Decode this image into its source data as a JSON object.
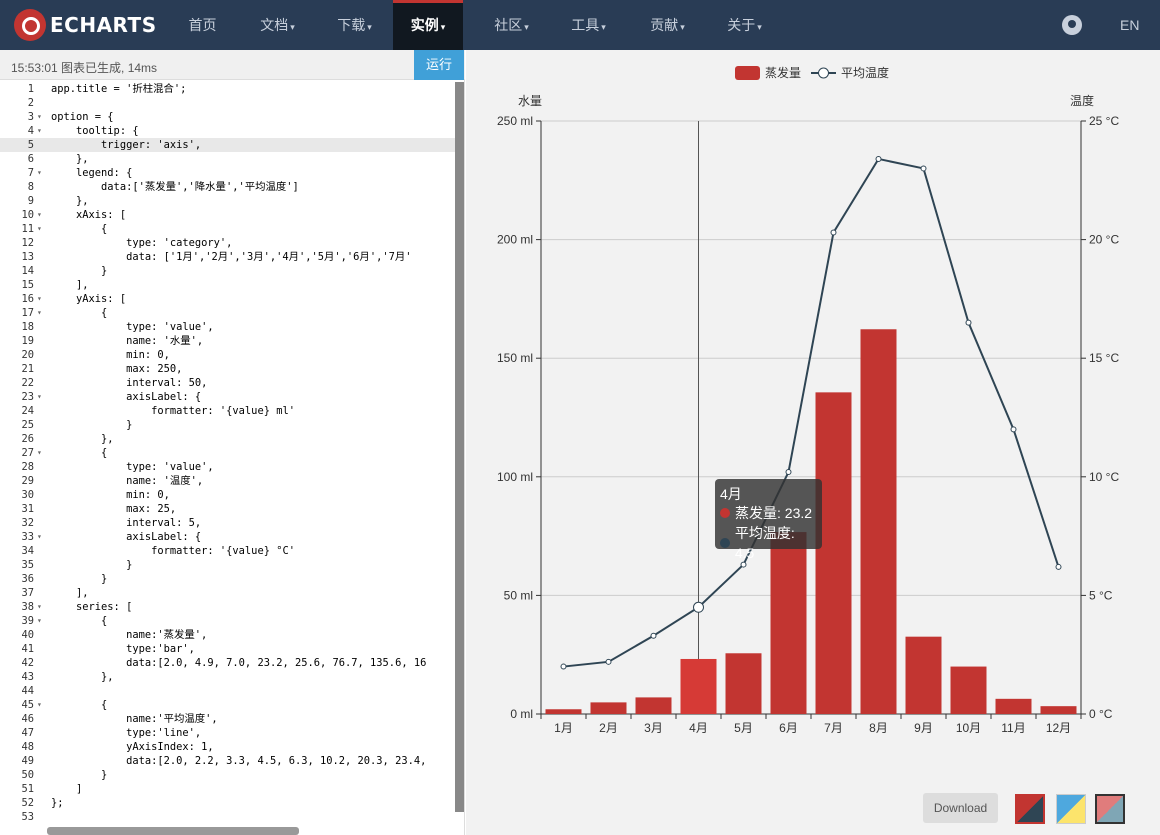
{
  "nav": {
    "logo": "ECHARTS",
    "items": [
      {
        "label": "首页",
        "caret": ""
      },
      {
        "label": "文档",
        "caret": "▾"
      },
      {
        "label": "下载",
        "caret": "▾"
      },
      {
        "label": "实例",
        "caret": "▾"
      },
      {
        "label": "社区",
        "caret": "▾"
      },
      {
        "label": "工具",
        "caret": "▾"
      },
      {
        "label": "贡献",
        "caret": "▾"
      },
      {
        "label": "关于",
        "caret": "▾"
      }
    ],
    "active_index": 3,
    "lang": "EN"
  },
  "editor": {
    "status": "15:53:01   图表已生成, 14ms",
    "run_label": "运行",
    "active_line": 5,
    "lines": [
      {
        "n": "1",
        "fold": "",
        "text": "app.title = '折柱混合';"
      },
      {
        "n": "2",
        "fold": "",
        "text": ""
      },
      {
        "n": "3",
        "fold": "▾",
        "text": "option = {"
      },
      {
        "n": "4",
        "fold": "▾",
        "text": "    tooltip: {"
      },
      {
        "n": "5",
        "fold": "",
        "text": "        trigger: 'axis',"
      },
      {
        "n": "6",
        "fold": "",
        "text": "    },"
      },
      {
        "n": "7",
        "fold": "▾",
        "text": "    legend: {"
      },
      {
        "n": "8",
        "fold": "",
        "text": "        data:['蒸发量','降水量','平均温度']"
      },
      {
        "n": "9",
        "fold": "",
        "text": "    },"
      },
      {
        "n": "10",
        "fold": "▾",
        "text": "    xAxis: ["
      },
      {
        "n": "11",
        "fold": "▾",
        "text": "        {"
      },
      {
        "n": "12",
        "fold": "",
        "text": "            type: 'category',"
      },
      {
        "n": "13",
        "fold": "",
        "text": "            data: ['1月','2月','3月','4月','5月','6月','7月'"
      },
      {
        "n": "14",
        "fold": "",
        "text": "        }"
      },
      {
        "n": "15",
        "fold": "",
        "text": "    ],"
      },
      {
        "n": "16",
        "fold": "▾",
        "text": "    yAxis: ["
      },
      {
        "n": "17",
        "fold": "▾",
        "text": "        {"
      },
      {
        "n": "18",
        "fold": "",
        "text": "            type: 'value',"
      },
      {
        "n": "19",
        "fold": "",
        "text": "            name: '水量',"
      },
      {
        "n": "20",
        "fold": "",
        "text": "            min: 0,"
      },
      {
        "n": "21",
        "fold": "",
        "text": "            max: 250,"
      },
      {
        "n": "22",
        "fold": "",
        "text": "            interval: 50,"
      },
      {
        "n": "23",
        "fold": "▾",
        "text": "            axisLabel: {"
      },
      {
        "n": "24",
        "fold": "",
        "text": "                formatter: '{value} ml'"
      },
      {
        "n": "25",
        "fold": "",
        "text": "            }"
      },
      {
        "n": "26",
        "fold": "",
        "text": "        },"
      },
      {
        "n": "27",
        "fold": "▾",
        "text": "        {"
      },
      {
        "n": "28",
        "fold": "",
        "text": "            type: 'value',"
      },
      {
        "n": "29",
        "fold": "",
        "text": "            name: '温度',"
      },
      {
        "n": "30",
        "fold": "",
        "text": "            min: 0,"
      },
      {
        "n": "31",
        "fold": "",
        "text": "            max: 25,"
      },
      {
        "n": "32",
        "fold": "",
        "text": "            interval: 5,"
      },
      {
        "n": "33",
        "fold": "▾",
        "text": "            axisLabel: {"
      },
      {
        "n": "34",
        "fold": "",
        "text": "                formatter: '{value} °C'"
      },
      {
        "n": "35",
        "fold": "",
        "text": "            }"
      },
      {
        "n": "36",
        "fold": "",
        "text": "        }"
      },
      {
        "n": "37",
        "fold": "",
        "text": "    ],"
      },
      {
        "n": "38",
        "fold": "▾",
        "text": "    series: ["
      },
      {
        "n": "39",
        "fold": "▾",
        "text": "        {"
      },
      {
        "n": "40",
        "fold": "",
        "text": "            name:'蒸发量',"
      },
      {
        "n": "41",
        "fold": "",
        "text": "            type:'bar',"
      },
      {
        "n": "42",
        "fold": "",
        "text": "            data:[2.0, 4.9, 7.0, 23.2, 25.6, 76.7, 135.6, 16"
      },
      {
        "n": "43",
        "fold": "",
        "text": "        },"
      },
      {
        "n": "44",
        "fold": "",
        "text": ""
      },
      {
        "n": "45",
        "fold": "▾",
        "text": "        {"
      },
      {
        "n": "46",
        "fold": "",
        "text": "            name:'平均温度',"
      },
      {
        "n": "47",
        "fold": "",
        "text": "            type:'line',"
      },
      {
        "n": "48",
        "fold": "",
        "text": "            yAxisIndex: 1,"
      },
      {
        "n": "49",
        "fold": "",
        "text": "            data:[2.0, 2.2, 3.3, 4.5, 6.3, 10.2, 20.3, 23.4,"
      },
      {
        "n": "50",
        "fold": "",
        "text": "        }"
      },
      {
        "n": "51",
        "fold": "",
        "text": "    ]"
      },
      {
        "n": "52",
        "fold": "",
        "text": "};"
      },
      {
        "n": "53",
        "fold": "",
        "text": ""
      }
    ]
  },
  "tooltip": {
    "title": "4月",
    "rows": [
      {
        "label": "蒸发量: 23.2",
        "color": "#c23531"
      },
      {
        "label": "平均温度: 4.5",
        "color": "#2f4554"
      }
    ]
  },
  "toolbar": {
    "download_label": "Download"
  },
  "chart_data": {
    "type": "bar",
    "categories": [
      "1月",
      "2月",
      "3月",
      "4月",
      "5月",
      "6月",
      "7月",
      "8月",
      "9月",
      "10月",
      "11月",
      "12月"
    ],
    "series": [
      {
        "name": "蒸发量",
        "type": "bar",
        "color": "#c23531",
        "values": [
          2.0,
          4.9,
          7.0,
          23.2,
          25.6,
          76.7,
          135.6,
          162.2,
          32.6,
          20.0,
          6.4,
          3.3
        ]
      },
      {
        "name": "平均温度",
        "type": "line",
        "color": "#2f4554",
        "yAxisIndex": 1,
        "values": [
          2.0,
          2.2,
          3.3,
          4.5,
          6.3,
          10.2,
          20.3,
          23.4,
          23.0,
          16.5,
          12.0,
          6.2
        ]
      }
    ],
    "legend": [
      "蒸发量",
      "平均温度"
    ],
    "ylabel_left": "水量",
    "ylabel_right": "温度",
    "ylim_left": [
      0,
      250
    ],
    "yinterval_left": 50,
    "yunit_left": "ml",
    "ylim_right": [
      0,
      25
    ],
    "yinterval_right": 5,
    "yunit_right": "°C",
    "highlighted_category": "4月",
    "grid": true
  }
}
